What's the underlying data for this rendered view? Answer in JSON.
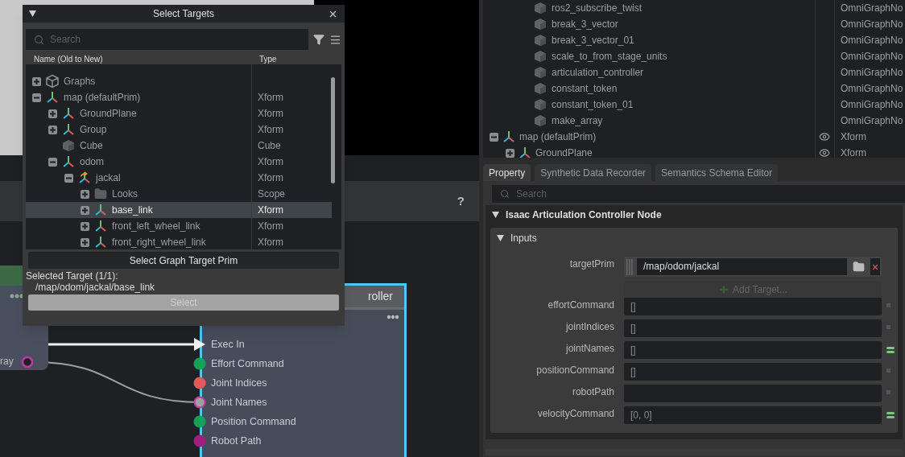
{
  "graph_editor": {
    "help": "?",
    "left_node": {
      "port_label": "ray"
    },
    "controller_node": {
      "title": "roller",
      "pins": [
        {
          "kind": "exec",
          "label": "Exec In"
        },
        {
          "kind": "data",
          "label": "Effort Command",
          "color": "#17a05a",
          "connected": false
        },
        {
          "kind": "data",
          "label": "Joint Indices",
          "color": "#e05a5a",
          "connected": false
        },
        {
          "kind": "data",
          "label": "Joint Names",
          "color": "#c03aa0",
          "connected": true
        },
        {
          "kind": "data",
          "label": "Position Command",
          "color": "#17a05a",
          "connected": false
        },
        {
          "kind": "data",
          "label": "Robot Path",
          "color": "#a01f7c",
          "connected": false
        }
      ]
    }
  },
  "dialog": {
    "title": "Select Targets",
    "search": {
      "placeholder": "Search"
    },
    "columns": [
      "Name (Old to New)",
      "Type"
    ],
    "tree": [
      {
        "name": "Graphs",
        "kind": "graphs",
        "expanded": false,
        "selected": false
      },
      {
        "name": "map (defaultPrim)",
        "kind": "xform",
        "type": "Xform",
        "expanded": true,
        "selected": false,
        "children": [
          {
            "name": "GroundPlane",
            "kind": "xform",
            "type": "Xform",
            "expanded": false,
            "selected": false
          },
          {
            "name": "Group",
            "kind": "xform",
            "type": "Xform",
            "expanded": false,
            "selected": false
          },
          {
            "name": "Cube",
            "kind": "cube",
            "type": "Cube",
            "selected": false
          },
          {
            "name": "odom",
            "kind": "xform",
            "type": "Xform",
            "expanded": true,
            "selected": false,
            "children": [
              {
                "name": "jackal",
                "kind": "robot",
                "type": "Xform",
                "expanded": true,
                "selected": false,
                "children": [
                  {
                    "name": "Looks",
                    "kind": "folder",
                    "type": "Scope",
                    "expanded": false,
                    "selected": false
                  },
                  {
                    "name": "base_link",
                    "kind": "xform",
                    "type": "Xform",
                    "expanded": false,
                    "selected": true
                  },
                  {
                    "name": "front_left_wheel_link",
                    "kind": "xform",
                    "type": "Xform",
                    "expanded": false,
                    "selected": false
                  },
                  {
                    "name": "front_right_wheel_link",
                    "kind": "xform",
                    "type": "Xform",
                    "expanded": false,
                    "selected": false
                  }
                ]
              }
            ]
          }
        ]
      }
    ],
    "graph_target_button": "Select Graph Target Prim",
    "selected_label": "Selected Target (1/1):",
    "selected_path": "/map/odom/jackal/base_link",
    "select_button": {
      "label": "Select",
      "disabled": true
    }
  },
  "stage": {
    "continued_nodes": [
      {
        "name": "ros2_subscribe_twist",
        "type": "OmniGraphNo"
      },
      {
        "name": "break_3_vector",
        "type": "OmniGraphNo"
      },
      {
        "name": "break_3_vector_01",
        "type": "OmniGraphNo"
      },
      {
        "name": "scale_to_from_stage_units",
        "type": "OmniGraphNo"
      },
      {
        "name": "articulation_controller",
        "type": "OmniGraphNo"
      },
      {
        "name": "constant_token",
        "type": "OmniGraphNo"
      },
      {
        "name": "constant_token_01",
        "type": "OmniGraphNo"
      },
      {
        "name": "make_array",
        "type": "OmniGraphNo"
      }
    ],
    "items": [
      {
        "name": "map (defaultPrim)",
        "kind": "xform",
        "type": "Xform",
        "expanded": true,
        "visible": true,
        "children": [
          {
            "name": "GroundPlane",
            "kind": "xform",
            "type": "Xform",
            "expanded": false,
            "visible": true
          }
        ]
      }
    ]
  },
  "property": {
    "tabs": [
      {
        "label": "Property",
        "selected": true
      },
      {
        "label": "Synthetic Data Recorder",
        "selected": false
      },
      {
        "label": "Semantics Schema Editor",
        "selected": false
      }
    ],
    "search": {
      "placeholder": "Search"
    },
    "section": {
      "title": "Isaac Articulation Controller Node",
      "expanded": true,
      "group": {
        "title": "Inputs",
        "expanded": true,
        "target": {
          "label": "targetPrim",
          "value": "/map/odom/jackal",
          "add_button": "Add Target..."
        },
        "fields": [
          {
            "label": "effortCommand",
            "value": "[]",
            "connected": false
          },
          {
            "label": "jointIndices",
            "value": "[]",
            "connected": false
          },
          {
            "label": "jointNames",
            "value": "[]",
            "connected": true
          },
          {
            "label": "positionCommand",
            "value": "[]",
            "connected": false
          },
          {
            "label": "robotPath",
            "connected": false
          },
          {
            "label": "velocityCommand",
            "value": "[0, 0]",
            "connected": true
          }
        ]
      }
    }
  }
}
